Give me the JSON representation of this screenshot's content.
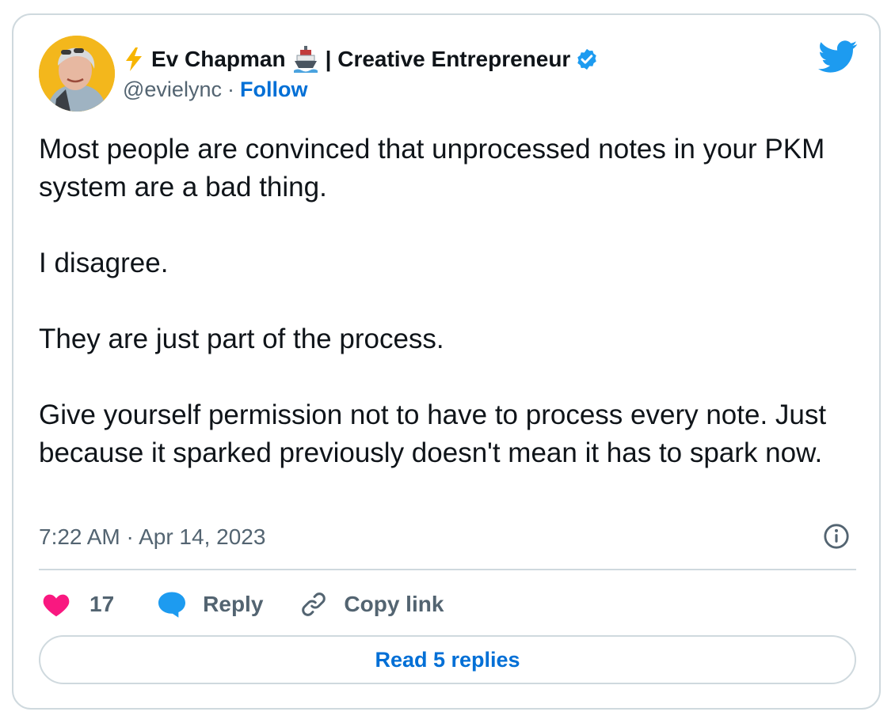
{
  "author": {
    "name": "Ev Chapman",
    "title_suffix": "| Creative Entrepreneur",
    "handle": "@evielync",
    "separator": "·",
    "follow_label": "Follow",
    "leading_emoji": "lightning-bolt",
    "inline_emoji": "ship",
    "verified": true
  },
  "tweet": {
    "paragraphs": [
      "Most people are convinced that unprocessed notes in your PKM system are a bad thing.",
      "I disagree.",
      "They are just part of the process.",
      "Give yourself permission not to have to process every note. Just because it sparked previously doesn't mean it has to spark now."
    ],
    "timestamp": "7:22 AM · Apr 14, 2023"
  },
  "actions": {
    "like_count": "17",
    "reply_label": "Reply",
    "copy_label": "Copy link"
  },
  "read_replies_label": "Read 5 replies",
  "icons": {
    "brand": "twitter-bird-icon",
    "like": "heart-icon",
    "reply": "speech-bubble-icon",
    "copy": "link-icon",
    "info": "info-icon"
  },
  "colors": {
    "accent": "#1d9bf0",
    "link": "#006fd6",
    "heart": "#f91880",
    "text": "#0f1419",
    "muted": "#536471",
    "border": "#cfd9de"
  }
}
